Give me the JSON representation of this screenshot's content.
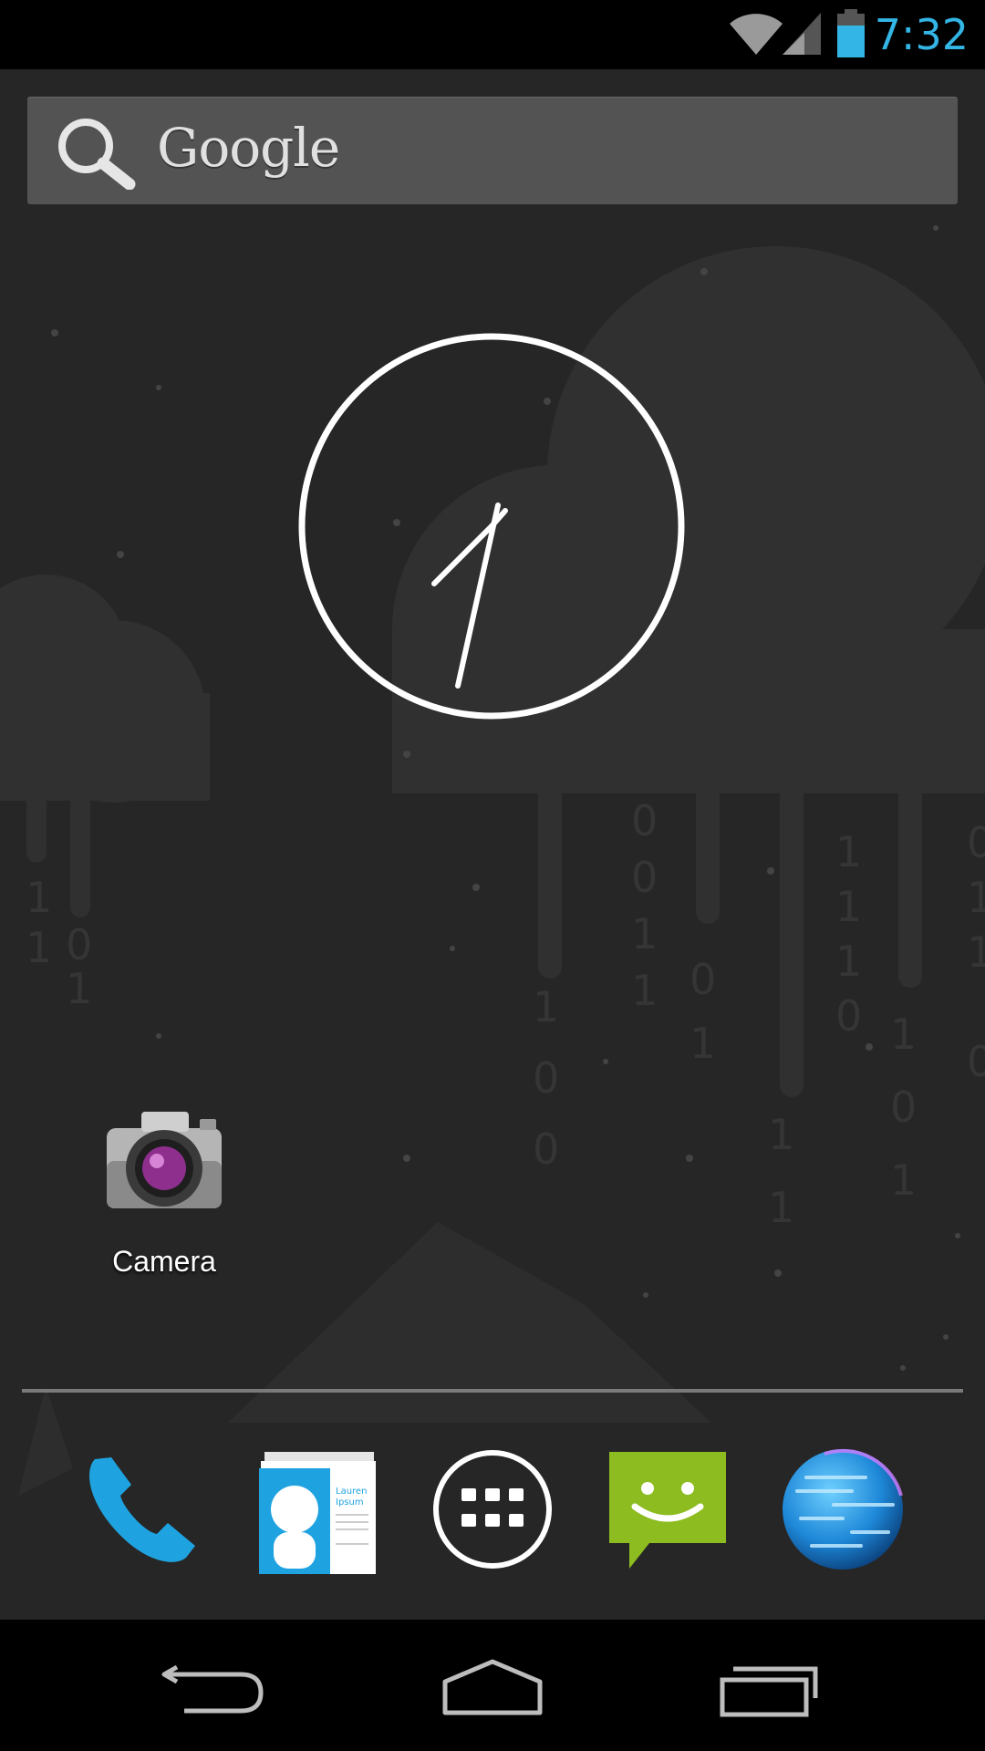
{
  "status_bar": {
    "time": "7:32",
    "icons": [
      "wifi-icon",
      "cell-signal-icon",
      "battery-icon"
    ],
    "accent_color": "#33b5e5"
  },
  "search": {
    "label": "Google",
    "icon": "search-icon"
  },
  "clock_widget": {
    "type": "analog-clock",
    "hour_hand_angle_deg": 228,
    "minute_hand_angle_deg": 196
  },
  "home_shortcuts": [
    {
      "label": "Camera",
      "icon": "camera-icon"
    }
  ],
  "dock": [
    {
      "icon": "phone-icon",
      "color": "#1fa3e0"
    },
    {
      "icon": "contacts-icon",
      "card_text": "Lauren\nIpsum"
    },
    {
      "icon": "app-drawer-icon"
    },
    {
      "icon": "messaging-icon",
      "color": "#8cbc1f"
    },
    {
      "icon": "browser-globe-icon",
      "color": "#1e88d8"
    }
  ],
  "nav_bar": [
    {
      "icon": "back-icon"
    },
    {
      "icon": "home-icon"
    },
    {
      "icon": "recent-apps-icon"
    }
  ]
}
